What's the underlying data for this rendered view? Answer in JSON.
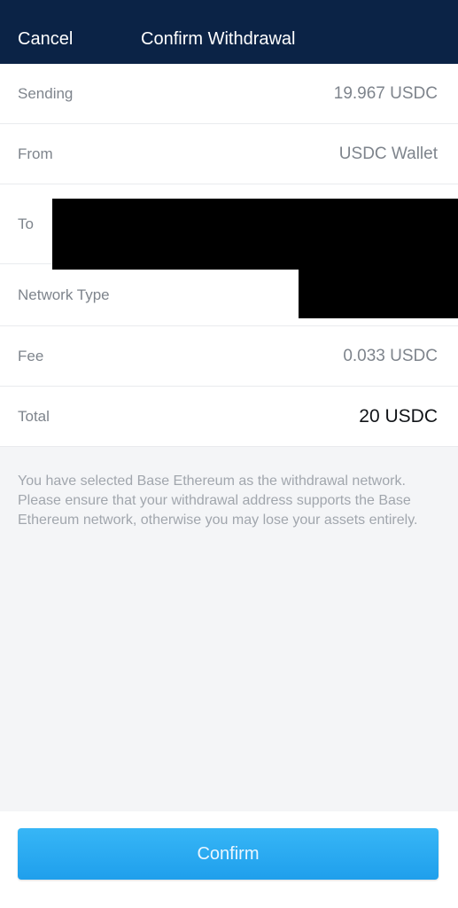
{
  "header": {
    "cancel_label": "Cancel",
    "title": "Confirm Withdrawal"
  },
  "rows": {
    "sending": {
      "label": "Sending",
      "value": "19.967 USDC"
    },
    "from": {
      "label": "From",
      "value": "USDC Wallet"
    },
    "to": {
      "label": "To"
    },
    "network_type": {
      "label": "Network Type"
    },
    "fee": {
      "label": "Fee",
      "value": "0.033 USDC"
    },
    "total": {
      "label": "Total",
      "value": "20 USDC"
    }
  },
  "notice": "You have selected Base Ethereum as the withdrawal network. Please ensure that your withdrawal address supports the Base Ethereum network, otherwise you may lose your assets entirely.",
  "footer": {
    "confirm_label": "Confirm"
  },
  "colors": {
    "header_bg": "#0b2346",
    "confirm_button": "#29aaf0"
  }
}
